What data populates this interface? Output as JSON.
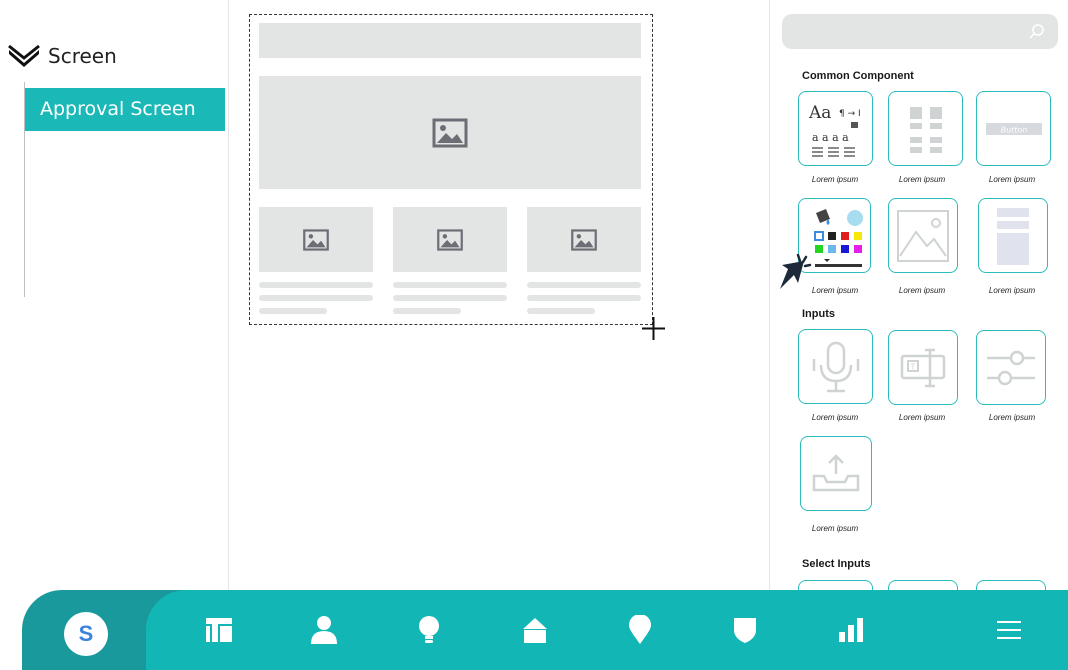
{
  "tree": {
    "root_label": "Screen",
    "items": [
      {
        "label": "Approval Screen"
      }
    ]
  },
  "search": {
    "placeholder": "",
    "icon": "search-icon"
  },
  "panel": {
    "sections": [
      {
        "title": "Common Component",
        "items": [
          {
            "caption": "Lorem ipsum",
            "icon": "typography-icon",
            "sample_big": "Aa",
            "sample_mark": "¶ → I",
            "sample_small": "a a a a"
          },
          {
            "caption": "Lorem ipsum",
            "icon": "layout-grid-icon"
          },
          {
            "caption": "Lorem ipsum",
            "icon": "button-icon",
            "button_text": "Button"
          },
          {
            "caption": "Lorem ipsum",
            "icon": "color-palette-icon"
          },
          {
            "caption": "Lorem ipsum",
            "icon": "image-placeholder-icon"
          },
          {
            "caption": "Lorem ipsum",
            "icon": "layout-blocks-icon"
          }
        ]
      },
      {
        "title": "Inputs",
        "items": [
          {
            "caption": "Lorem ipsum",
            "icon": "microphone-icon"
          },
          {
            "caption": "Lorem ipsum",
            "icon": "text-field-icon"
          },
          {
            "caption": "Lorem ipsum",
            "icon": "sliders-icon"
          },
          {
            "caption": "Lorem ipsum",
            "icon": "upload-icon"
          }
        ]
      },
      {
        "title": "Select Inputs",
        "items": []
      }
    ]
  },
  "colors": {
    "accent": "#1bb8b8",
    "nav_bg": "#12b7b5",
    "nav_dark": "#19999b",
    "wireframe": "#e3e5e5",
    "avatar_letter": "#3b83dd"
  },
  "nav": {
    "avatar_letter": "S",
    "items": [
      "dashboard-icon",
      "user-icon",
      "lightbulb-icon",
      "home-icon",
      "location-pin-icon",
      "shield-icon",
      "bar-chart-icon",
      "menu-icon"
    ]
  }
}
